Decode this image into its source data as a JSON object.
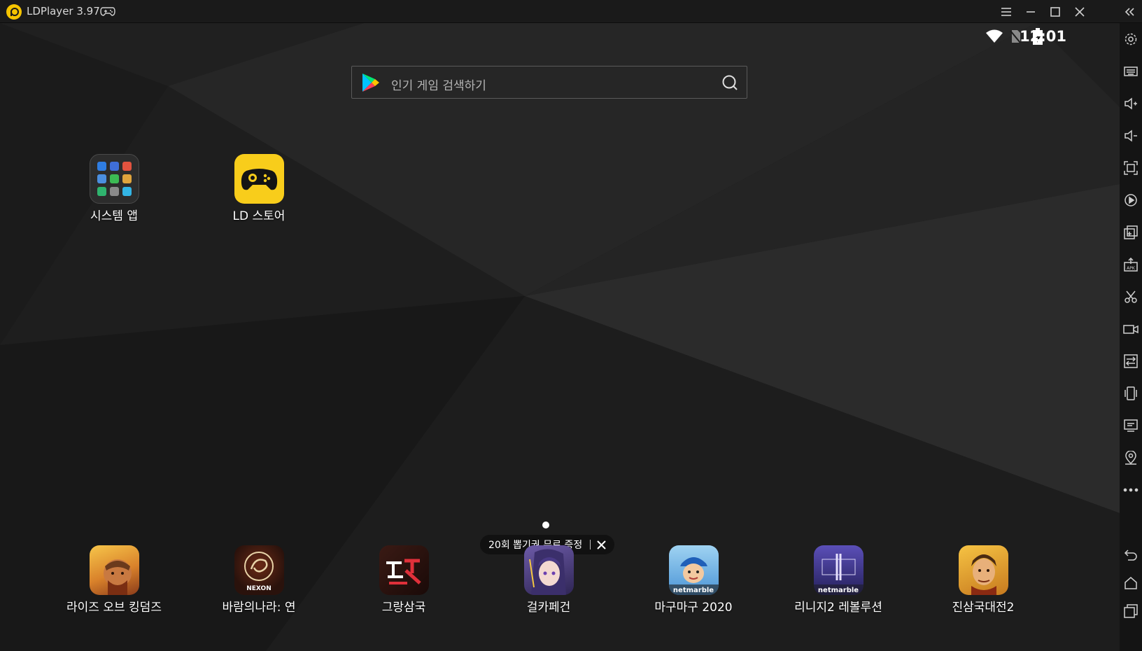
{
  "window": {
    "title": "LDPlayer 3.97"
  },
  "status_bar": {
    "time": "12:01"
  },
  "search": {
    "placeholder": "인기 게임 검색하기"
  },
  "desktop_apps": [
    {
      "label": "시스템 앱",
      "icon": "folder-icon"
    },
    {
      "label": "LD 스토어",
      "icon": "ld-store-icon"
    }
  ],
  "dock_apps": [
    {
      "label": "라이즈 오브 킹덤즈",
      "icon": "rise-of-kingdoms-icon",
      "colors": [
        "#f5a623",
        "#c0392b"
      ]
    },
    {
      "label": "바람의나라: 연",
      "icon": "baram-icon",
      "badge": "NEXON",
      "colors": [
        "#3a1a12",
        "#8b3a1e"
      ]
    },
    {
      "label": "그랑삼국",
      "icon": "grand-sanguo-icon",
      "colors": [
        "#2b1410",
        "#c0392b"
      ]
    },
    {
      "label": "걸카페건",
      "icon": "girl-cafe-gun-icon",
      "colors": [
        "#4a3a7a",
        "#d9c4f0"
      ]
    },
    {
      "label": "마구마구 2020",
      "icon": "magumagu-icon",
      "badge": "netmarble",
      "colors": [
        "#5aa9e6",
        "#ffffff"
      ]
    },
    {
      "label": "리니지2 레볼루션",
      "icon": "lineage2-icon",
      "badge": "netmarble",
      "colors": [
        "#2b2a6b",
        "#6b5fc4"
      ]
    },
    {
      "label": "진삼국대전2",
      "icon": "jin-sanguo-icon",
      "colors": [
        "#e8a317",
        "#a0522d"
      ]
    }
  ],
  "promo": {
    "text": "20회 뽑기권 무료 증정"
  },
  "toolbar": {
    "items": [
      "settings-icon",
      "keyboard-icon",
      "volume-up-icon",
      "volume-down-icon",
      "fullscreen-icon",
      "macro-icon",
      "multi-instance-icon",
      "install-apk-icon",
      "screenshot-icon",
      "record-icon",
      "sync-icon",
      "shake-icon",
      "virtual-display-icon",
      "location-icon",
      "more-icon",
      "back-icon",
      "home-icon",
      "recent-apps-icon"
    ]
  },
  "colors": {
    "accent": "#f8cd1b",
    "background": "#1c1c1c",
    "titlebar": "#1a1a1a"
  }
}
